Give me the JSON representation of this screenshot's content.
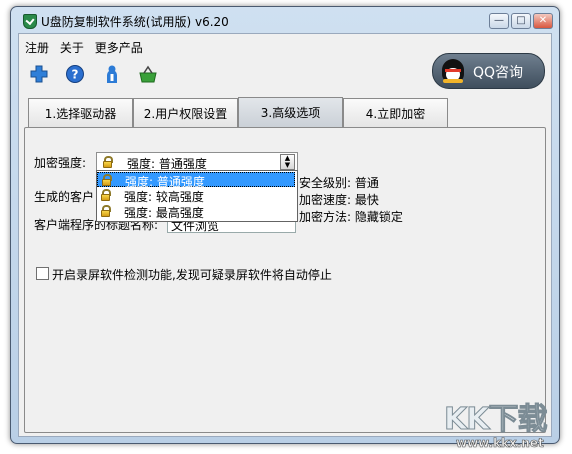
{
  "window": {
    "title": "U盘防复制软件系统(试用版) v6.20",
    "buttons": {
      "minimize": "—",
      "maximize": "□",
      "close": "✕"
    }
  },
  "menu": [
    "注册",
    "关于",
    "更多产品"
  ],
  "toolbar": {
    "icons": [
      "plus-icon",
      "help-icon",
      "user-icon",
      "basket-icon"
    ]
  },
  "qq_button": {
    "label": "QQ咨询"
  },
  "tabs": [
    {
      "label": "1.选择驱动器",
      "active": false
    },
    {
      "label": "2.用户权限设置",
      "active": false
    },
    {
      "label": "3.高级选项",
      "active": true
    },
    {
      "label": "4.立即加密",
      "active": false
    }
  ],
  "advanced": {
    "encrypt_strength_label": "加密强度:",
    "encrypt_strength_value": "强度: 普通强度",
    "options": [
      "强度: 普通强度",
      "强度: 较高强度",
      "强度: 最高强度"
    ],
    "selected_option_index": 0,
    "generated_client_label": "生成的客户",
    "client_title_label": "客户端程序的标题名称:",
    "client_title_value": "文件浏览",
    "security_level": "安全级别: 普通",
    "encrypt_speed": "加密速度: 最快",
    "encrypt_method": "加密方法: 隐藏锁定",
    "screen_record_checkbox": {
      "label": "开启录屏软件检测功能,发现可疑录屏软件将自动停止",
      "checked": false
    }
  },
  "watermark": {
    "text": "KK下载",
    "url": "www.kkx.net"
  }
}
